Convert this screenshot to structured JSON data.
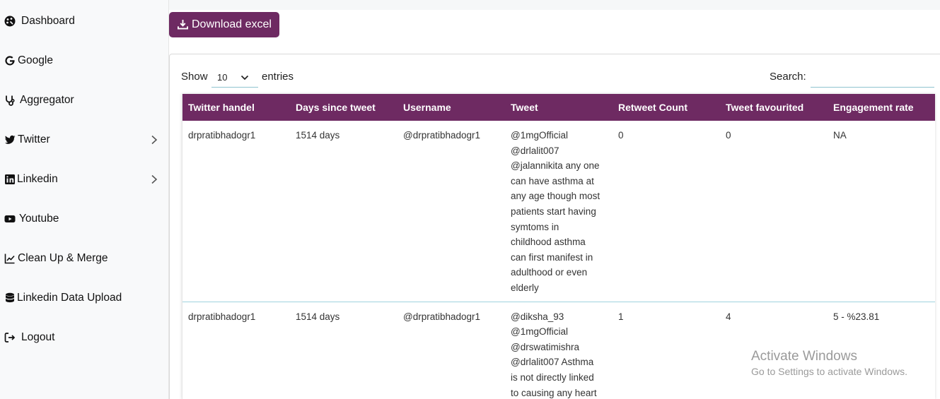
{
  "sidebar": {
    "items": [
      {
        "label": "Dashboard",
        "icon": "palette-icon"
      },
      {
        "label": "Google",
        "icon": "google-icon"
      },
      {
        "label": "Aggregator",
        "icon": "stethoscope-icon"
      },
      {
        "label": "Twitter",
        "icon": "twitter-icon",
        "has_submenu": true
      },
      {
        "label": "Linkedin",
        "icon": "linkedin-icon",
        "has_submenu": true
      },
      {
        "label": "Youtube",
        "icon": "youtube-icon"
      },
      {
        "label": "Clean Up & Merge",
        "icon": "chart-line-icon"
      },
      {
        "label": "Linkedin Data Upload",
        "icon": "database-icon"
      },
      {
        "label": "Logout",
        "icon": "logout-icon"
      }
    ]
  },
  "toolbar": {
    "download_label": "Download excel"
  },
  "controls": {
    "show_label": "Show",
    "entries_value": "10",
    "entries_label": "entries",
    "search_label": "Search:",
    "search_value": ""
  },
  "table": {
    "headers": [
      "Twitter handel",
      "Days since tweet",
      "Username",
      "Tweet",
      "Retweet Count",
      "Tweet favourited",
      "Engagement rate"
    ],
    "rows": [
      {
        "handle": "drpratibhadogr1",
        "days": "1514 days",
        "username": "@drpratibhadogr1",
        "tweet_lines": [
          "@1mgOfficial",
          "@drlalit007",
          "@jalannikita any one",
          "can have asthma at",
          "any age though most",
          "patients start having",
          "symtoms in",
          "childhood asthma",
          "can first manifest in",
          "adulthood or even",
          "elderly"
        ],
        "retweets": "0",
        "favourited": "0",
        "engagement": "NA"
      },
      {
        "handle": "drpratibhadogr1",
        "days": "1514 days",
        "username": "@drpratibhadogr1",
        "tweet_lines": [
          "@diksha_93",
          "@1mgOfficial",
          "@drswatimishra",
          "@drlalit007 Asthma",
          "is not directly linked",
          "to causing any heart"
        ],
        "retweets": "1",
        "favourited": "4",
        "engagement": "5 - %23.81"
      }
    ]
  },
  "watermark": {
    "title": "Activate Windows",
    "subtitle": "Go to Settings to activate Windows."
  },
  "colors": {
    "brand": "#6e2a62",
    "row_divider": "#9fd3de"
  }
}
